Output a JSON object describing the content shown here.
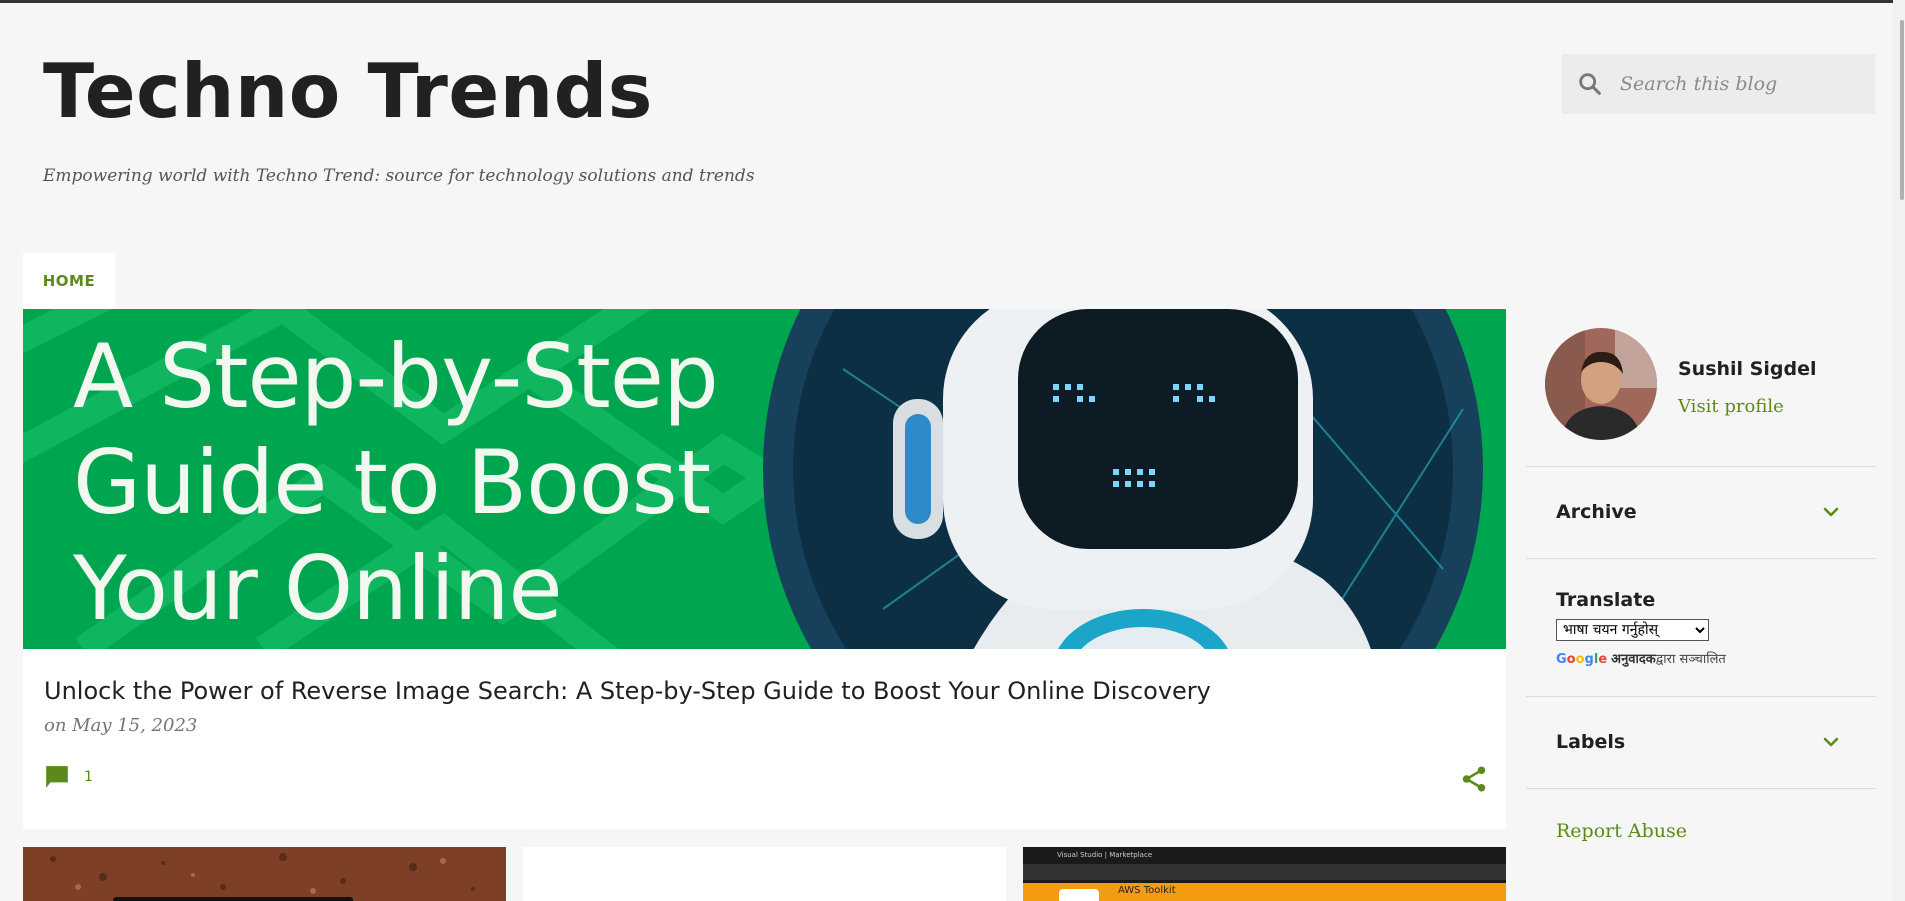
{
  "header": {
    "title": "Techno Trends",
    "description": "Empowering world with Techno Trend: source for technology solutions and trends"
  },
  "search": {
    "placeholder": "Search this blog",
    "icon": "search-icon"
  },
  "nav": {
    "home_label": "HOME"
  },
  "featured_post": {
    "image_text_line1": "A Step-by-Step",
    "image_text_line2": "Guide to Boost",
    "image_text_line3": "Your Online",
    "title": "Unlock the Power of Reverse Image Search: A Step-by-Step Guide to Boost Your Online Discovery",
    "date": "on May 15, 2023",
    "comment_count": "1",
    "comment_icon": "comment-icon",
    "share_icon": "share-icon"
  },
  "thumbs": {
    "third_label": "AWS Toolkit",
    "third_brand": "Visual Studio | Marketplace"
  },
  "sidebar": {
    "profile": {
      "name": "Sushil Sigdel",
      "visit_label": "Visit profile"
    },
    "archive_title": "Archive",
    "translate_title": "Translate",
    "translate_select": "भाषा चयन गर्नुहोस्",
    "translate_powered": "अनुवादक",
    "translate_suffix": "द्वारा सञ्चालित",
    "google_brand": "Google",
    "labels_title": "Labels",
    "report_abuse": "Report Abuse"
  },
  "colors": {
    "accent": "#5c8a1a",
    "hero_green": "#00a550",
    "background": "#f6f6f6"
  }
}
